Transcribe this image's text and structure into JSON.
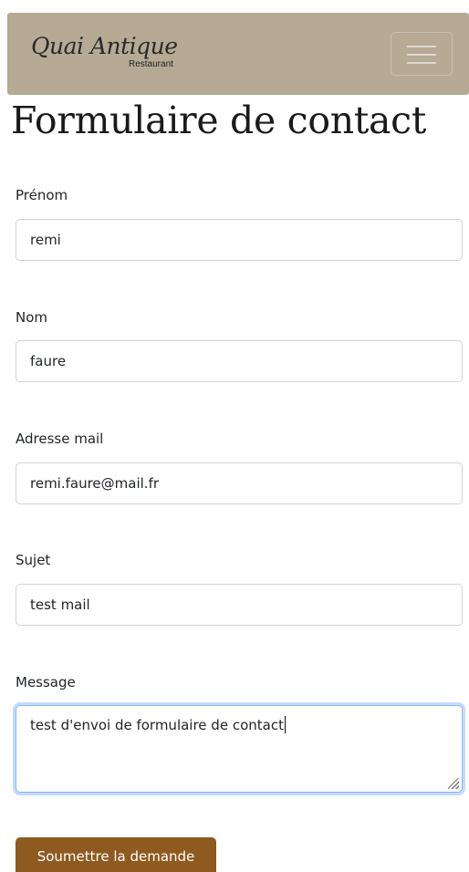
{
  "navbar": {
    "brand_name": "Quai Antique",
    "brand_subtitle": "Restaurant",
    "menu_icon": "hamburger-menu-icon"
  },
  "page": {
    "title": "Formulaire de contact"
  },
  "form": {
    "fields": [
      {
        "label": "Prénom",
        "value": "remi"
      },
      {
        "label": "Nom",
        "value": "faure"
      },
      {
        "label": "Adresse mail",
        "value": "remi.faure@mail.fr"
      },
      {
        "label": "Sujet",
        "value": "test mail"
      }
    ],
    "message": {
      "label": "Message",
      "value": "test d'envoi de formulaire de contact"
    },
    "submit_label": "Soumettre la demande"
  },
  "colors": {
    "navbar_bg": "#b6aa94",
    "button_bg": "#8e5a1f",
    "focus_border": "#86b7fe"
  }
}
